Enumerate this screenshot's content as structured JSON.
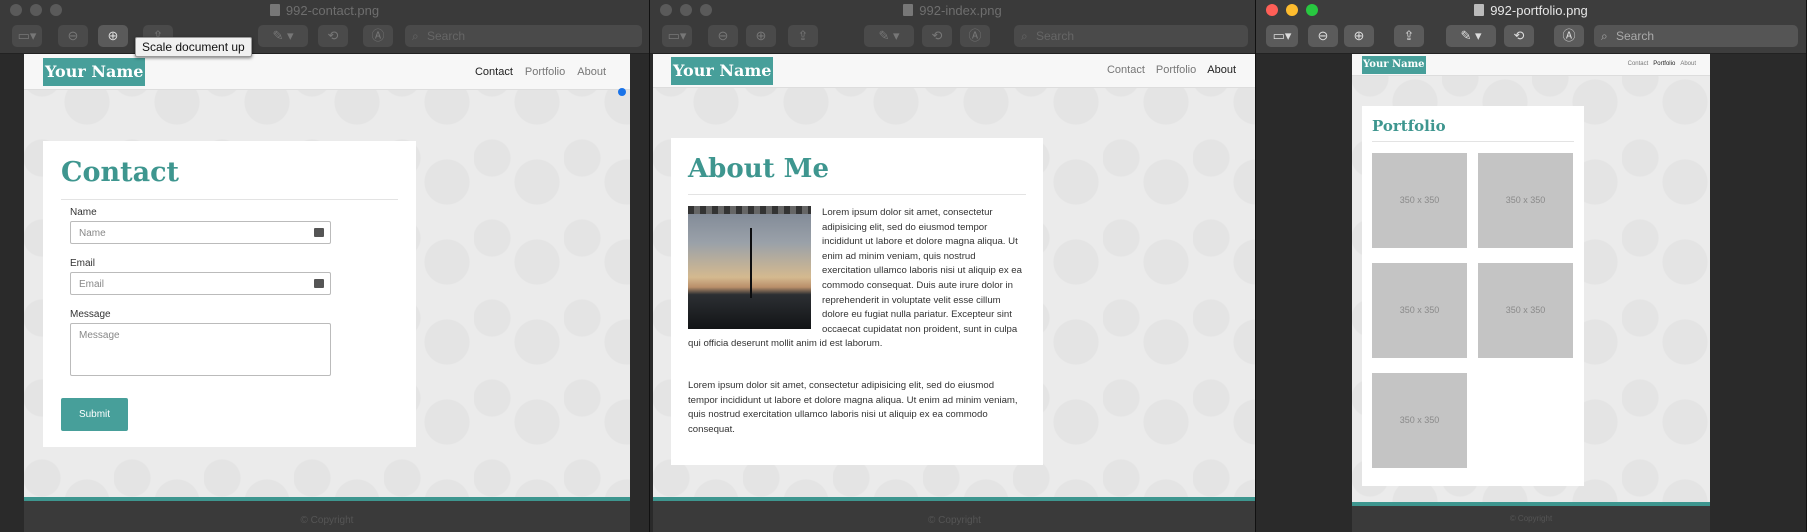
{
  "windows": {
    "contact": {
      "title": "992-contact.png",
      "search_placeholder": "Search",
      "tooltip": "Scale document up",
      "site": {
        "brand": "Your Name",
        "nav": [
          "Contact",
          "Portfolio",
          "About"
        ],
        "active_nav": "Contact",
        "heading": "Contact",
        "form": {
          "name_label": "Name",
          "name_placeholder": "Name",
          "email_label": "Email",
          "email_placeholder": "Email",
          "message_label": "Message",
          "message_placeholder": "Message",
          "submit_label": "Submit"
        },
        "footer": "© Copyright"
      }
    },
    "index": {
      "title": "992-index.png",
      "search_placeholder": "Search",
      "site": {
        "brand": "Your Name",
        "nav": [
          "Contact",
          "Portfolio",
          "About"
        ],
        "active_nav": "About",
        "heading": "About Me",
        "paragraph1": "Lorem ipsum dolor sit amet, consectetur adipisicing elit, sed do eiusmod tempor incididunt ut labore et dolore magna aliqua. Ut enim ad minim veniam, quis nostrud exercitation ullamco laboris nisi ut aliquip ex ea commodo consequat. Duis aute irure dolor in reprehenderit in voluptate velit esse cillum dolore eu fugiat nulla pariatur. Excepteur sint occaecat cupidatat non proident, sunt in culpa qui officia deserunt mollit anim id est laborum.",
        "paragraph2": "Lorem ipsum dolor sit amet, consectetur adipisicing elit, sed do eiusmod tempor incididunt ut labore et dolore magna aliqua. Ut enim ad minim veniam, quis nostrud exercitation ullamco laboris nisi ut aliquip ex ea commodo consequat.",
        "footer": "© Copyright"
      }
    },
    "portfolio": {
      "title": "992-portfolio.png",
      "search_placeholder": "Search",
      "site": {
        "brand": "Your Name",
        "nav": [
          "Contact",
          "Portfolio",
          "About"
        ],
        "active_nav": "Portfolio",
        "heading": "Portfolio",
        "thumbnails": [
          "350 x 350",
          "350 x 350",
          "350 x 350",
          "350 x 350",
          "350 x 350"
        ],
        "footer": "© Copyright"
      }
    }
  },
  "colors": {
    "accent": "#479f9a",
    "heading": "#3e968f",
    "traffic_red": "#ff5f57",
    "traffic_yellow": "#febc2e",
    "traffic_green": "#28c840"
  },
  "toolbar_icons": [
    "sidebar-toggle-icon",
    "zoom-out-icon",
    "zoom-in-icon",
    "share-icon",
    "markup-pen-icon",
    "rotate-icon",
    "annotate-icon",
    "search-icon"
  ]
}
